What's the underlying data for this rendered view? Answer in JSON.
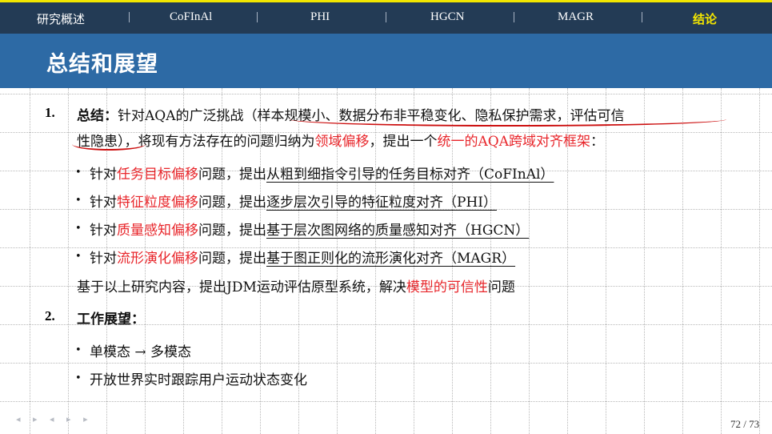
{
  "nav": {
    "items": [
      "研究概述",
      "CoFInAl",
      "PHI",
      "HGCN",
      "MAGR",
      "结论"
    ],
    "separator": "|",
    "active": "结论"
  },
  "title": "总结和展望",
  "summary": {
    "number": "1.",
    "label": "总结",
    "colon": "：",
    "line1_a": "针对AQA的广泛挑战（",
    "line1_b": "样本规模小、数据分布非平稳变化、隐私保护需求，评估可信",
    "line2_a": "性隐患",
    "line2_b": "），将现有方法存在的问题归纳为",
    "line2_red1": "领域偏移",
    "line2_c": "，提出一个",
    "line2_red2": "统一的AQA跨域对齐框架",
    "line2_d": "：",
    "bullets": [
      {
        "pre": "针对",
        "red": "任务目标偏移",
        "mid": "问题，提出",
        "ul": "从粗到细指令引导的任务目标对齐（CoFInAl）"
      },
      {
        "pre": "针对",
        "red": "特征粒度偏移",
        "mid": "问题，提出",
        "ul": "逐步层次引导的特征粒度对齐（PHI）"
      },
      {
        "pre": "针对",
        "red": "质量感知偏移",
        "mid": "问题，提出",
        "ul": "基于层次图网络的质量感知对齐（HGCN）"
      },
      {
        "pre": "针对",
        "red": "流形演化偏移",
        "mid": "问题，提出",
        "ul": "基于图正则化的流形演化对齐（MAGR）"
      }
    ],
    "closing_a": "基于以上研究内容，提出JDM运动评估原型系统，解决",
    "closing_red": "模型的可信性",
    "closing_b": "问题"
  },
  "outlook": {
    "number": "2.",
    "label": "工作展望",
    "colon": "：",
    "bullets": [
      "单模态 → 多模态",
      "开放世界实时跟踪用户运动状态变化"
    ]
  },
  "controls": "◂ ▸ ◂ ▸ ▸",
  "page": "72 / 73",
  "colors": {
    "nav_bg": "#233b55",
    "title_bg": "#2d6aa5",
    "accent_red": "#e8262b",
    "active_nav": "#f3e600"
  }
}
